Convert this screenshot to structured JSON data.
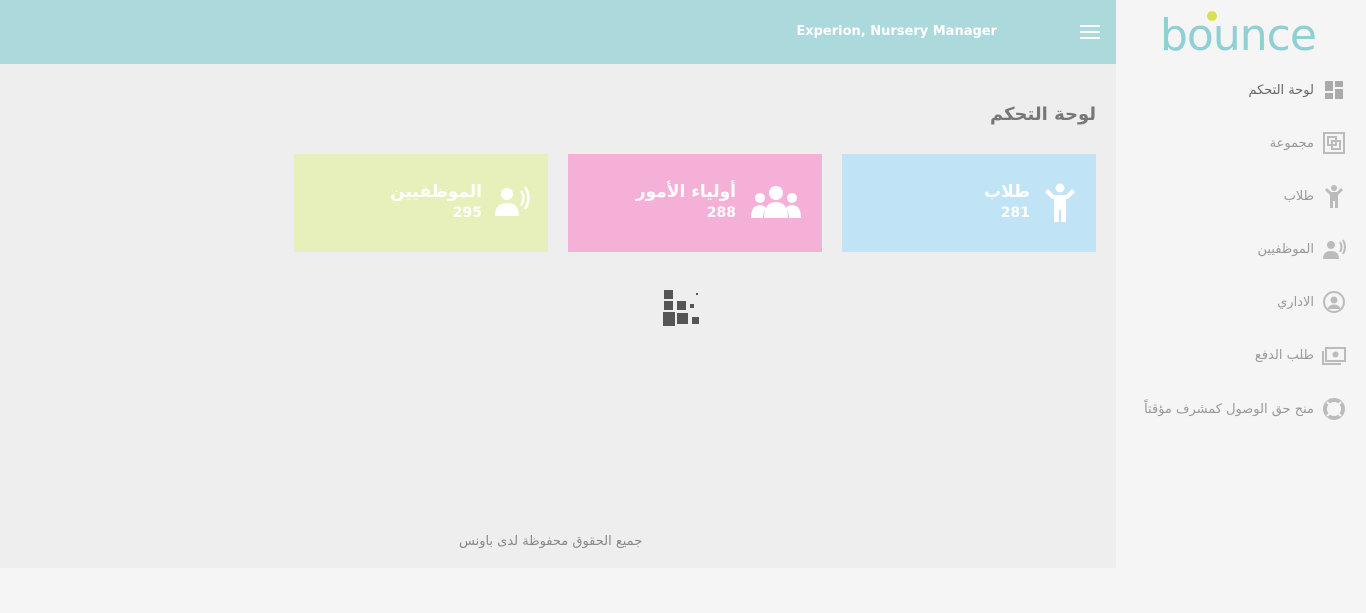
{
  "header": {
    "user_label": "Experion, Nursery Manager"
  },
  "page": {
    "title": "لوحة التحكم"
  },
  "cards": {
    "students": {
      "label": "طلاب",
      "count": "281",
      "color": "#c0e3f6"
    },
    "parents": {
      "label": "أولياء الأمور",
      "count": "288",
      "color": "#f5b0d8"
    },
    "staff": {
      "label": "الموظفيين",
      "count": "295",
      "color": "#e7f0bb"
    }
  },
  "footer": {
    "text": "جميع الحقوق محفوظة لدى باونس"
  },
  "sidebar": {
    "logo_text": "bounce",
    "items": [
      {
        "label": "لوحة التحكم",
        "icon": "dashboard-icon"
      },
      {
        "label": "مجموعة",
        "icon": "group-icon"
      },
      {
        "label": "طلاب",
        "icon": "child-icon"
      },
      {
        "label": "الموظفيين",
        "icon": "staff-icon"
      },
      {
        "label": "الاداري",
        "icon": "admin-icon"
      },
      {
        "label": "طلب الدفع",
        "icon": "payment-icon"
      },
      {
        "label": "منح حق الوصول كمشرف مؤقتاً",
        "icon": "lifebuoy-icon"
      }
    ]
  },
  "colors": {
    "header": "#acd9db",
    "main_bg": "#eeeeee",
    "sidebar_bg": "#f5f5f5",
    "logo_teal": "#8fd0d4",
    "logo_yellow": "#d6e24f"
  }
}
